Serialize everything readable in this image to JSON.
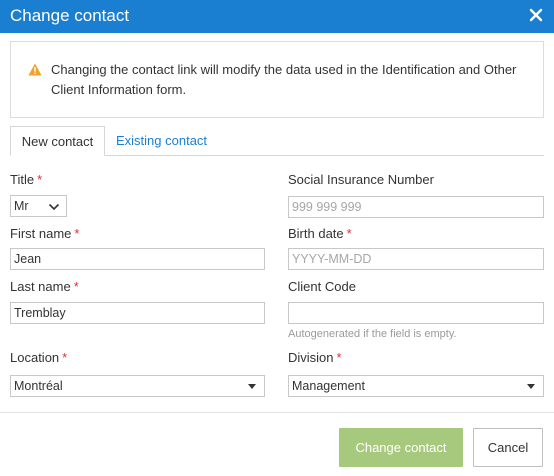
{
  "dialog": {
    "title": "Change contact",
    "close_icon": "close-icon"
  },
  "notice": {
    "icon": "warning-icon",
    "icon_color": "#f0a22e",
    "text": "Changing the contact link will modify the data used in the Identification and Other Client Information form."
  },
  "tabs": [
    {
      "label": "New contact",
      "active": true
    },
    {
      "label": "Existing contact",
      "active": false
    }
  ],
  "form": {
    "required_mark": "*",
    "title": {
      "label": "Title",
      "value": "Mr"
    },
    "sin": {
      "label": "Social Insurance Number",
      "placeholder": "999 999 999"
    },
    "first_name": {
      "label": "First name",
      "value": "Jean"
    },
    "birth_date": {
      "label": "Birth date",
      "placeholder": "YYYY-MM-DD"
    },
    "last_name": {
      "label": "Last name",
      "value": "Tremblay"
    },
    "client_code": {
      "label": "Client Code",
      "value": "",
      "hint": "Autogenerated if the field is empty."
    },
    "location": {
      "label": "Location",
      "value": "Montréal"
    },
    "division": {
      "label": "Division",
      "value": "Management"
    }
  },
  "buttons": {
    "primary": "Change contact",
    "cancel": "Cancel"
  },
  "colors": {
    "header": "#1b7fd1",
    "link": "#1b7fd1",
    "required": "#d9303b",
    "primary_button": "#a7c97d"
  }
}
